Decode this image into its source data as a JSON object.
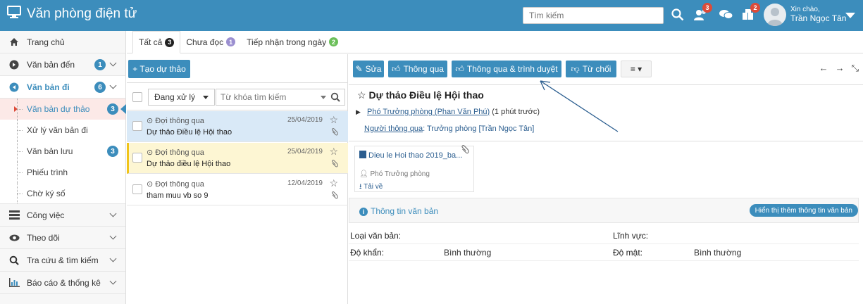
{
  "app": {
    "title": "Văn phòng điện tử"
  },
  "search": {
    "placeholder": "Tìm kiếm"
  },
  "top_icons": [
    {
      "icon": "users-icon",
      "badge": "3"
    },
    {
      "icon": "chat-icon",
      "badge": ""
    },
    {
      "icon": "puzzle-icon",
      "badge": "2"
    }
  ],
  "user": {
    "greeting": "Xin chào,",
    "name": "Trần Ngọc Tân"
  },
  "sidebar": {
    "home": "Trang chủ",
    "incoming": {
      "label": "Văn bản đến",
      "count": "1"
    },
    "outgoing": {
      "label": "Văn bản đi",
      "count": "6"
    },
    "sub": [
      {
        "label": "Văn bản dự thảo",
        "count": "3"
      },
      {
        "label": "Xử lý văn bản đi",
        "count": ""
      },
      {
        "label": "Văn bản lưu",
        "count": "3"
      },
      {
        "label": "Phiếu trình",
        "count": ""
      },
      {
        "label": "Chờ ký số",
        "count": ""
      }
    ],
    "work": "Công việc",
    "follow": "Theo dõi",
    "lookup": "Tra cứu & tìm kiếm",
    "reports": "Báo cáo & thống kê"
  },
  "tabs": [
    {
      "label": "Tất cả",
      "badge": "3",
      "color": "#222222"
    },
    {
      "label": "Chưa đọc",
      "badge": "1",
      "color": "#9b8fd0"
    },
    {
      "label": "Tiếp nhận trong ngày",
      "badge": "2",
      "color": "#6bbf59"
    }
  ],
  "list": {
    "create_label": "+ Tạo dự thảo",
    "filter_value": "Đang xử lý",
    "keyword_placeholder": "Từ khóa tìm kiếm",
    "rows": [
      {
        "status": "⊙ Đợi thông qua",
        "title": "Dự thảo Điều lệ Hội thao",
        "date": "25/04/2019"
      },
      {
        "status": "⊙ Đợi thông qua",
        "title": "Dự thảo điều lệ Hội thao",
        "date": "25/04/2019"
      },
      {
        "status": "⊙ Đợi thông qua",
        "title": "tham muu vb so 9",
        "date": "12/04/2019"
      }
    ]
  },
  "toolbar": {
    "edit": "Sửa",
    "approve": "Thông qua",
    "approve_submit": "Thông qua & trình duyệt",
    "reject": "Từ chối"
  },
  "detail": {
    "title": "Dự thảo Điều lệ Hội thao",
    "author_link": "Phó Trưởng phòng (Phan Văn Phú)",
    "author_time": "(1 phút trước)",
    "approver_label": "Người thông qua",
    "approver_value": ": Trưởng phòng [Trần Ngọc Tân]",
    "attachment": {
      "file": "Dieu le Hoi thao 2019_ba...",
      "uploader": "Phó Trưởng phòng",
      "download": "Tải về"
    },
    "info_title": "Thông tin văn bản",
    "info_more": "Hiển thị thêm thông tin văn bản",
    "fields": {
      "doc_type_label": "Loại văn bản:",
      "doc_type_value": "",
      "field_label": "Lĩnh vực:",
      "field_value": "",
      "urgency_label": "Độ khẩn:",
      "urgency_value": "Bình thường",
      "secrecy_label": "Độ mật:",
      "secrecy_value": "Bình thường"
    }
  }
}
